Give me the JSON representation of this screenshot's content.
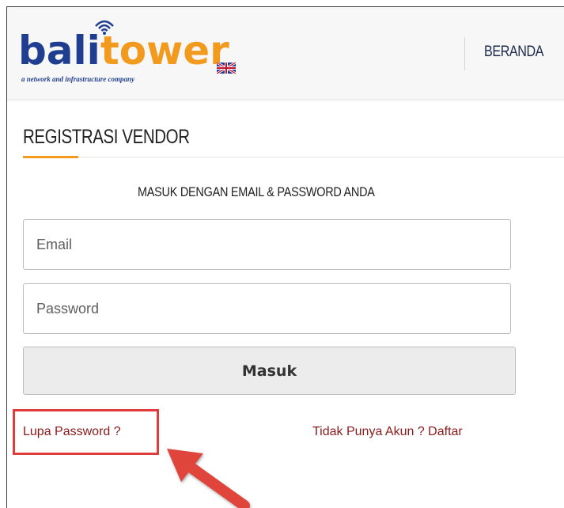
{
  "header": {
    "logo": {
      "brand_primary": "bali",
      "brand_secondary": "tower",
      "tagline": "a network and infrastructure company",
      "colors": {
        "primary": "#1f3e8f",
        "accent": "#f29a1e"
      }
    },
    "language_flag_icon": "uk-flag-icon",
    "nav": {
      "beranda": "BERANDA"
    }
  },
  "page": {
    "title": "REGISTRASI VENDOR",
    "login_caption": "MASUK DENGAN EMAIL & PASSWORD ANDA"
  },
  "form": {
    "email_placeholder": "Email",
    "password_placeholder": "Password",
    "submit_label": "Masuk"
  },
  "links": {
    "forgot_password": "Lupa Password ?",
    "register": "Tidak Punya Akun ? Daftar",
    "link_color": "#8b1a1a"
  },
  "annotation": {
    "highlight_color": "#e03c3c",
    "arrow_icon": "pointer-arrow-icon"
  }
}
